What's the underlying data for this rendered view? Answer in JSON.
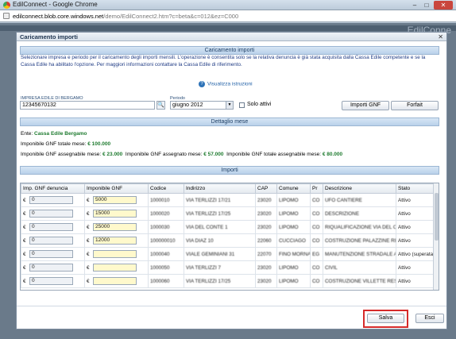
{
  "browser": {
    "title": "EdilConnect - Google Chrome",
    "url_host": "edilconnect.blob.core.windows.net",
    "url_path": "/demo/EdilConnect2.htm?c=beta&c=012&ez=C000",
    "minimize": "–",
    "maximize": "□",
    "close": "✕"
  },
  "background": {
    "brand": "EdilConne"
  },
  "dialog": {
    "title": "Caricamento importi",
    "close_glyph": "✕",
    "section_upload": "Caricamento importi",
    "info_text": "Selezionare impresa e periodo per il caricamento degli importi mensili. L'operazione è consentita solo se la relativa denuncia è già stata acquisita dalla Cassa Edile competente e se la Cassa Edile ha abilitato l'opzione. Per maggiori informazioni contattare la Cassa Edile di riferimento.",
    "help_link": "Visualizza istruzioni",
    "company_label": "IMPRESA EDILE DI BERGAMO",
    "company_value": "12345670132",
    "period_label": "Periodo",
    "period_value": "giugno 2012",
    "only_active_label": "Solo attivi",
    "btn_importi_gnf": "Importi GNF",
    "btn_forfait": "Forfait",
    "section_detail": "Dettaglio mese",
    "ente_label": "Ente:",
    "ente_value": "Cassa Edile Bergamo",
    "imp_tot_label": "Imponibile GNF totale mese:",
    "imp_tot_value": "€ 100.000",
    "imp_ass_label": "Imponibile GNF assegnabile mese:",
    "imp_ass_value": "€ 23.000",
    "imp_assegnato_label": "Imponibile GNF assegnato mese:",
    "imp_assegnato_value": "€ 57.000",
    "imp_tot_ass_label": "Imponibile GNF totale assegnabile mese:",
    "imp_tot_ass_value": "€ 80.000",
    "section_amounts": "Importi",
    "btn_save": "Salva",
    "btn_exit": "Esci"
  },
  "grid": {
    "columns": [
      "Imp. GNF denuncia",
      "Imponibile GNF",
      "Codice",
      "Indirizzo",
      "CAP",
      "Comune",
      "Pr",
      "Descrizione",
      "Stato"
    ],
    "currency": "€",
    "rows": [
      {
        "den": "0",
        "gnf": "5000",
        "code": "1000010",
        "addr": "VIA TERLIZZI 17/21",
        "cap": "23020",
        "comune": "LIPOMO",
        "pr": "CO",
        "desc": "UFO CANTIERE",
        "stato": "Attivo"
      },
      {
        "den": "0",
        "gnf": "15000",
        "code": "1000020",
        "addr": "VIA TERLIZZI 17/25",
        "cap": "23020",
        "comune": "LIPOMO",
        "pr": "CO",
        "desc": "DESCRIZIONE",
        "stato": "Attivo"
      },
      {
        "den": "0",
        "gnf": "25000",
        "code": "1000030",
        "addr": "VIA DEL CONTE 1",
        "cap": "23020",
        "comune": "LIPOMO",
        "pr": "CO",
        "desc": "RIQUALIFICAZIONE VIA DEL CONTE",
        "stato": "Attivo"
      },
      {
        "den": "0",
        "gnf": "12000",
        "code": "100000010",
        "addr": "VIA DIAZ 10",
        "cap": "22060",
        "comune": "CUCCIAGO",
        "pr": "CO",
        "desc": "COSTRUZIONE PALAZZINE RESIDENZIALI",
        "stato": "Attivo"
      },
      {
        "den": "0",
        "gnf": "",
        "code": "1000040",
        "addr": "VIALE GEMINIANI 31",
        "cap": "22070",
        "comune": "FINO MORNASCO",
        "pr": "EG",
        "desc": "MANUTENZIONE STRADALE ANTIRAVATIVA",
        "stato": "Attivo (superata fine)"
      },
      {
        "den": "0",
        "gnf": "",
        "code": "1000050",
        "addr": "VIA TERLIZZI 7",
        "cap": "23020",
        "comune": "LIPOMO",
        "pr": "CO",
        "desc": "CIVIL",
        "stato": "Attivo"
      },
      {
        "den": "0",
        "gnf": "",
        "code": "1000060",
        "addr": "VIA TERLIZZI 17/25",
        "cap": "23020",
        "comune": "LIPOMO",
        "pr": "CO",
        "desc": "COSTRUZIONE VILLETTE RESIDENZIALI",
        "stato": "Attivo"
      }
    ]
  }
}
